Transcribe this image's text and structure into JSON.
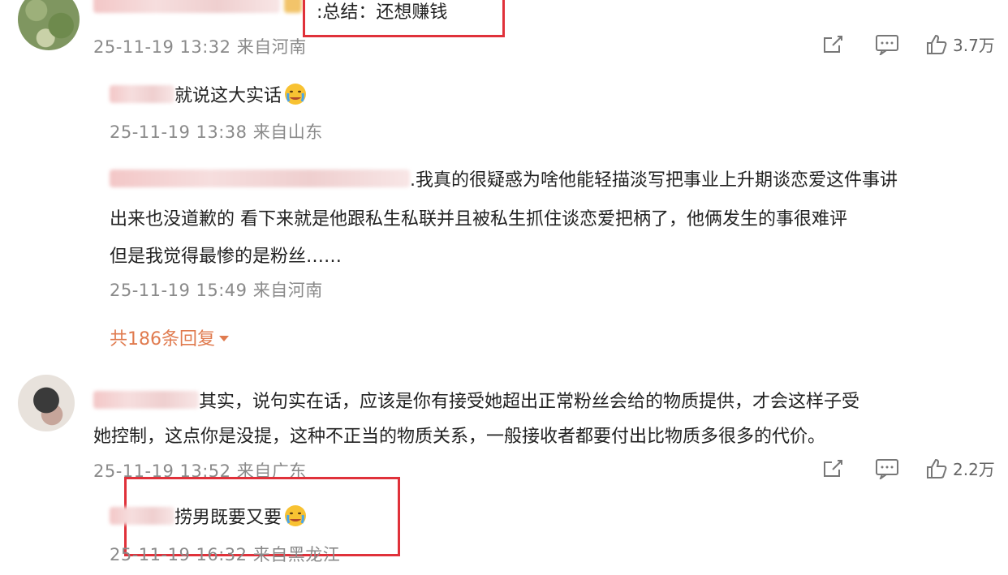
{
  "comments": [
    {
      "text": ":总结：还想赚钱",
      "meta": "25-11-19 13:32 来自河南",
      "likes": "3.7万"
    },
    {
      "text": "其实，说句实在话，应该是你有接受她超出正常粉丝会给的物质提供，才会这样子受",
      "text_line2": "她控制，这点你是没提，这种不正当的物质关系，一般接收者都要付出比物质多很多的代价。",
      "meta": "25-11-19 13:52 来自广东",
      "likes": "2.2万"
    }
  ],
  "replies": [
    {
      "text": "就说这大实话",
      "meta": "25-11-19 13:38 来自山东"
    },
    {
      "text": ".我真的很疑惑为啥他能轻描淡写把事业上升期谈恋爱这件事讲",
      "text_line2": "出来也没道歉的  看下来就是他跟私生私联并且被私生抓住谈恋爱把柄了，他俩发生的事很难评",
      "text_line3": "但是我觉得最惨的是粉丝……",
      "meta": "25-11-19 15:49 来自河南"
    },
    {
      "text": "捞男既要又要",
      "meta": "25-11-19 16:32 来自黑龙江"
    }
  ],
  "more_replies": "共186条回复",
  "icons": {
    "share": "share-icon",
    "comment": "comment-icon",
    "like": "thumbs-up-icon",
    "crying_emoji": "crying-emoji-icon",
    "dropdown": "caret-down-icon"
  },
  "colors": {
    "highlight_box": "#e0313a",
    "more_link": "#e07b4f"
  }
}
